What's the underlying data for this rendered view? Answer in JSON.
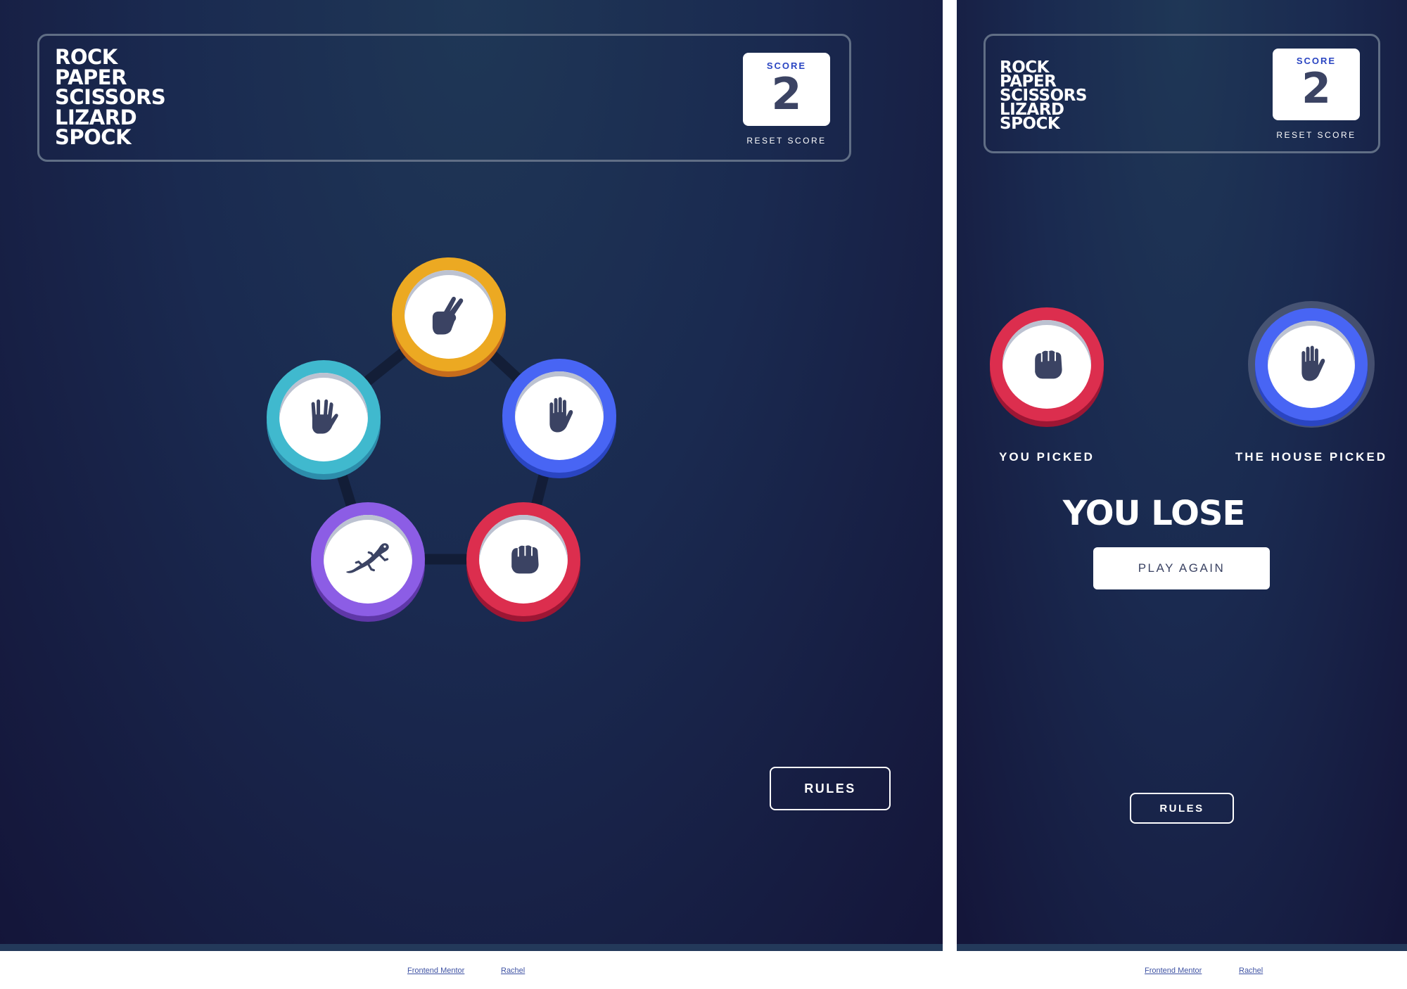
{
  "title_lines": [
    "ROCK",
    "PAPER",
    "SCISSORS",
    "LIZARD",
    "SPOCK"
  ],
  "score": {
    "label": "SCORE",
    "value": "2",
    "reset_label": "RESET SCORE"
  },
  "choices": [
    {
      "name": "scissors",
      "icon": "scissors-hand-icon",
      "color": "#eca922",
      "shade": "#c76c1b"
    },
    {
      "name": "paper",
      "icon": "paper-hand-icon",
      "color": "#4865f4",
      "shade": "#2a45c2"
    },
    {
      "name": "rock",
      "icon": "rock-hand-icon",
      "color": "#dc2e4e",
      "shade": "#9d1634"
    },
    {
      "name": "lizard",
      "icon": "lizard-icon",
      "color": "#8c5de5",
      "shade": "#5f37a8"
    },
    {
      "name": "spock",
      "icon": "spock-hand-icon",
      "color": "#40b9ce",
      "shade": "#2d8dab"
    }
  ],
  "rules_label": "RULES",
  "result_screen": {
    "you_picked_label": "YOU PICKED",
    "house_picked_label": "THE HOUSE PICKED",
    "user_choice": "rock",
    "house_choice": "paper",
    "result_text": "YOU LOSE",
    "play_again_label": "PLAY AGAIN"
  },
  "footer": {
    "link1": "Frontend Mentor",
    "link2": "Rachel"
  },
  "colors": {
    "background": "#1f3756",
    "background_dark": "#141539",
    "header_outline": "#606e85",
    "score_text": "#2a45c2",
    "dark_text": "#3b4363"
  }
}
